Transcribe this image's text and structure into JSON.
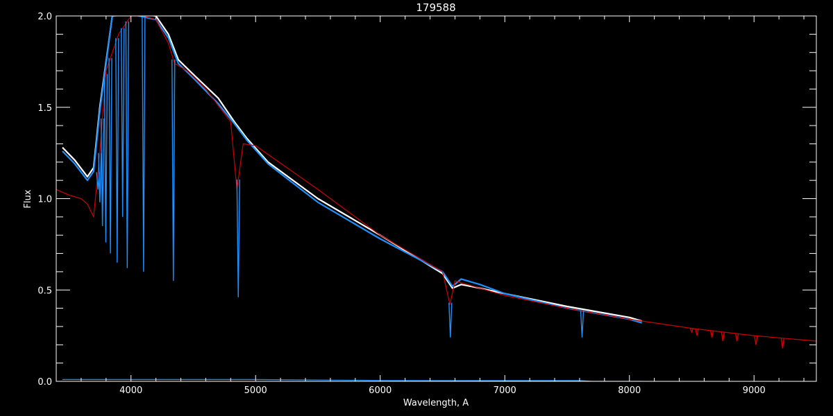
{
  "chart_data": {
    "type": "line",
    "title": "179588",
    "xlabel": "Wavelength, A",
    "ylabel": "Flux",
    "xlim": [
      3400,
      9500
    ],
    "ylim": [
      0.0,
      2.0
    ],
    "x_ticks": [
      4000,
      5000,
      6000,
      7000,
      8000,
      9000
    ],
    "x_tick_labels": [
      "4000",
      "5000",
      "6000",
      "7000",
      "8000",
      "9000"
    ],
    "y_ticks": [
      0.0,
      0.5,
      1.0,
      1.5,
      2.0
    ],
    "y_tick_labels": [
      "0.0",
      "0.5",
      "1.0",
      "1.5",
      "2.0"
    ],
    "grid": false,
    "series": [
      {
        "color": "#ffffff",
        "x": [
          3450,
          3550,
          3650,
          3700,
          3750,
          3850,
          4000,
          4200,
          4300,
          4380,
          4500,
          4700,
          4830,
          4930,
          5100,
          5500,
          6000,
          6500,
          6580,
          6650,
          6800,
          7000,
          7500,
          8000,
          8100
        ],
        "y": [
          1.28,
          1.21,
          1.12,
          1.17,
          1.5,
          2.0,
          2.02,
          2.0,
          1.9,
          1.76,
          1.68,
          1.55,
          1.42,
          1.33,
          1.2,
          1.0,
          0.8,
          0.59,
          0.51,
          0.53,
          0.51,
          0.48,
          0.41,
          0.35,
          0.33
        ]
      },
      {
        "color": "#1e90ff",
        "x": [
          3450,
          3550,
          3650,
          3700,
          3750,
          3850,
          4000,
          4200,
          4300,
          4380,
          4500,
          4700,
          4830,
          4930,
          5100,
          5500,
          6000,
          6500,
          6580,
          6650,
          6800,
          7000,
          7500,
          8000,
          8100
        ],
        "y": [
          1.26,
          1.19,
          1.1,
          1.15,
          1.48,
          2.0,
          2.01,
          1.98,
          1.88,
          1.74,
          1.66,
          1.52,
          1.41,
          1.32,
          1.19,
          0.98,
          0.78,
          0.6,
          0.52,
          0.56,
          0.53,
          0.48,
          0.4,
          0.34,
          0.32
        ]
      },
      {
        "color": "#cc0000",
        "x": [
          3400,
          3500,
          3600,
          3650,
          3700,
          3750,
          3800,
          3900,
          4000,
          4100,
          4200,
          4300,
          4350,
          4450,
          4600,
          4800,
          4850,
          4900,
          5000,
          5500,
          6000,
          6500,
          6560,
          6600,
          7000,
          7500,
          8000,
          8500,
          9000,
          9500
        ],
        "y": [
          1.05,
          1.02,
          1.0,
          0.97,
          0.9,
          1.25,
          1.7,
          1.9,
          2.0,
          2.0,
          1.98,
          1.85,
          1.74,
          1.7,
          1.6,
          1.42,
          1.05,
          1.3,
          1.29,
          1.05,
          0.8,
          0.6,
          0.42,
          0.55,
          0.47,
          0.4,
          0.34,
          0.29,
          0.25,
          0.22
        ]
      },
      {
        "color": "#1e90ff",
        "x": [
          3450,
          5000,
          6000,
          7000,
          7600,
          7700,
          8100
        ],
        "y": [
          0.01,
          0.01,
          0.005,
          0.004,
          0.004,
          0.0,
          0.0
        ]
      }
    ],
    "absorption_lines": [
      {
        "x": 3735,
        "depth_to": 1.05,
        "color": "#1e90ff"
      },
      {
        "x": 3750,
        "depth_to": 0.98,
        "color": "#1e90ff"
      },
      {
        "x": 3771,
        "depth_to": 0.85,
        "color": "#1e90ff"
      },
      {
        "x": 3798,
        "depth_to": 0.76,
        "color": "#1e90ff"
      },
      {
        "x": 3835,
        "depth_to": 0.7,
        "color": "#1e90ff"
      },
      {
        "x": 3889,
        "depth_to": 0.65,
        "color": "#1e90ff"
      },
      {
        "x": 3933,
        "depth_to": 0.9,
        "color": "#1e90ff"
      },
      {
        "x": 3970,
        "depth_to": 0.62,
        "color": "#1e90ff"
      },
      {
        "x": 4101,
        "depth_to": 0.6,
        "color": "#1e90ff"
      },
      {
        "x": 4340,
        "depth_to": 0.55,
        "color": "#1e90ff"
      },
      {
        "x": 4861,
        "depth_to": 0.46,
        "color": "#1e90ff"
      },
      {
        "x": 6563,
        "depth_to": 0.24,
        "color": "#1e90ff"
      },
      {
        "x": 7620,
        "depth_to": 0.24,
        "color": "#1e90ff"
      },
      {
        "x": 8500,
        "depth_to": 0.27,
        "color": "#cc0000"
      },
      {
        "x": 8542,
        "depth_to": 0.25,
        "color": "#cc0000"
      },
      {
        "x": 8662,
        "depth_to": 0.24,
        "color": "#cc0000"
      },
      {
        "x": 8750,
        "depth_to": 0.22,
        "color": "#cc0000"
      },
      {
        "x": 8863,
        "depth_to": 0.22,
        "color": "#cc0000"
      },
      {
        "x": 9015,
        "depth_to": 0.2,
        "color": "#cc0000"
      },
      {
        "x": 9229,
        "depth_to": 0.18,
        "color": "#cc0000"
      }
    ]
  }
}
